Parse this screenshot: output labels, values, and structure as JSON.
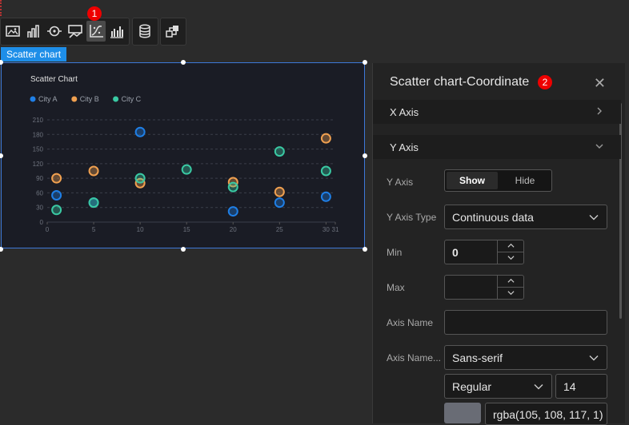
{
  "toolbar": {
    "badge": "1",
    "tools": [
      "image-icon",
      "bar-chart-icon",
      "target-icon",
      "picture-chart-icon",
      "scatter-chart-icon",
      "grouped-bar-icon",
      "database-icon",
      "link-shape-icon"
    ]
  },
  "widget": {
    "label": "Scatter chart"
  },
  "chart_data": {
    "type": "scatter",
    "title": "Scatter Chart",
    "legend_position": "top-left",
    "xlim": [
      0,
      31
    ],
    "ylim": [
      0,
      210
    ],
    "x_ticks": [
      0,
      5,
      10,
      15,
      20,
      25,
      30,
      31
    ],
    "y_ticks": [
      0,
      30,
      60,
      90,
      120,
      150,
      180,
      210
    ],
    "grid": true,
    "series": [
      {
        "name": "City A",
        "color": "#1f7fe6",
        "points": [
          [
            1,
            55
          ],
          [
            5,
            40
          ],
          [
            10,
            185
          ],
          [
            20,
            22
          ],
          [
            25,
            40
          ],
          [
            30,
            52
          ]
        ]
      },
      {
        "name": "City B",
        "color": "#f0a050",
        "points": [
          [
            1,
            90
          ],
          [
            5,
            105
          ],
          [
            10,
            80
          ],
          [
            20,
            82
          ],
          [
            25,
            62
          ],
          [
            30,
            172
          ]
        ]
      },
      {
        "name": "City C",
        "color": "#3ac9a3",
        "points": [
          [
            1,
            25
          ],
          [
            5,
            40
          ],
          [
            10,
            90
          ],
          [
            15,
            108
          ],
          [
            20,
            72
          ],
          [
            25,
            145
          ],
          [
            30,
            105
          ]
        ]
      }
    ]
  },
  "panel": {
    "title": "Scatter chart-Coordinate",
    "badge": "2",
    "x_axis_section": "X Axis",
    "y_axis_section": "Y Axis",
    "y_axis": {
      "label": "Y Axis",
      "show": "Show",
      "hide": "Hide",
      "selected": "Show"
    },
    "y_axis_type": {
      "label": "Y Axis Type",
      "value": "Continuous data"
    },
    "min": {
      "label": "Min",
      "value": "0"
    },
    "max": {
      "label": "Max",
      "value": ""
    },
    "axis_name": {
      "label": "Axis Name",
      "value": ""
    },
    "axis_name_font": {
      "label": "Axis Name...",
      "family": "Sans-serif",
      "weight": "Regular",
      "size": "14",
      "color": "rgba(105, 108, 117, 1)",
      "swatch": "#696c75"
    }
  }
}
